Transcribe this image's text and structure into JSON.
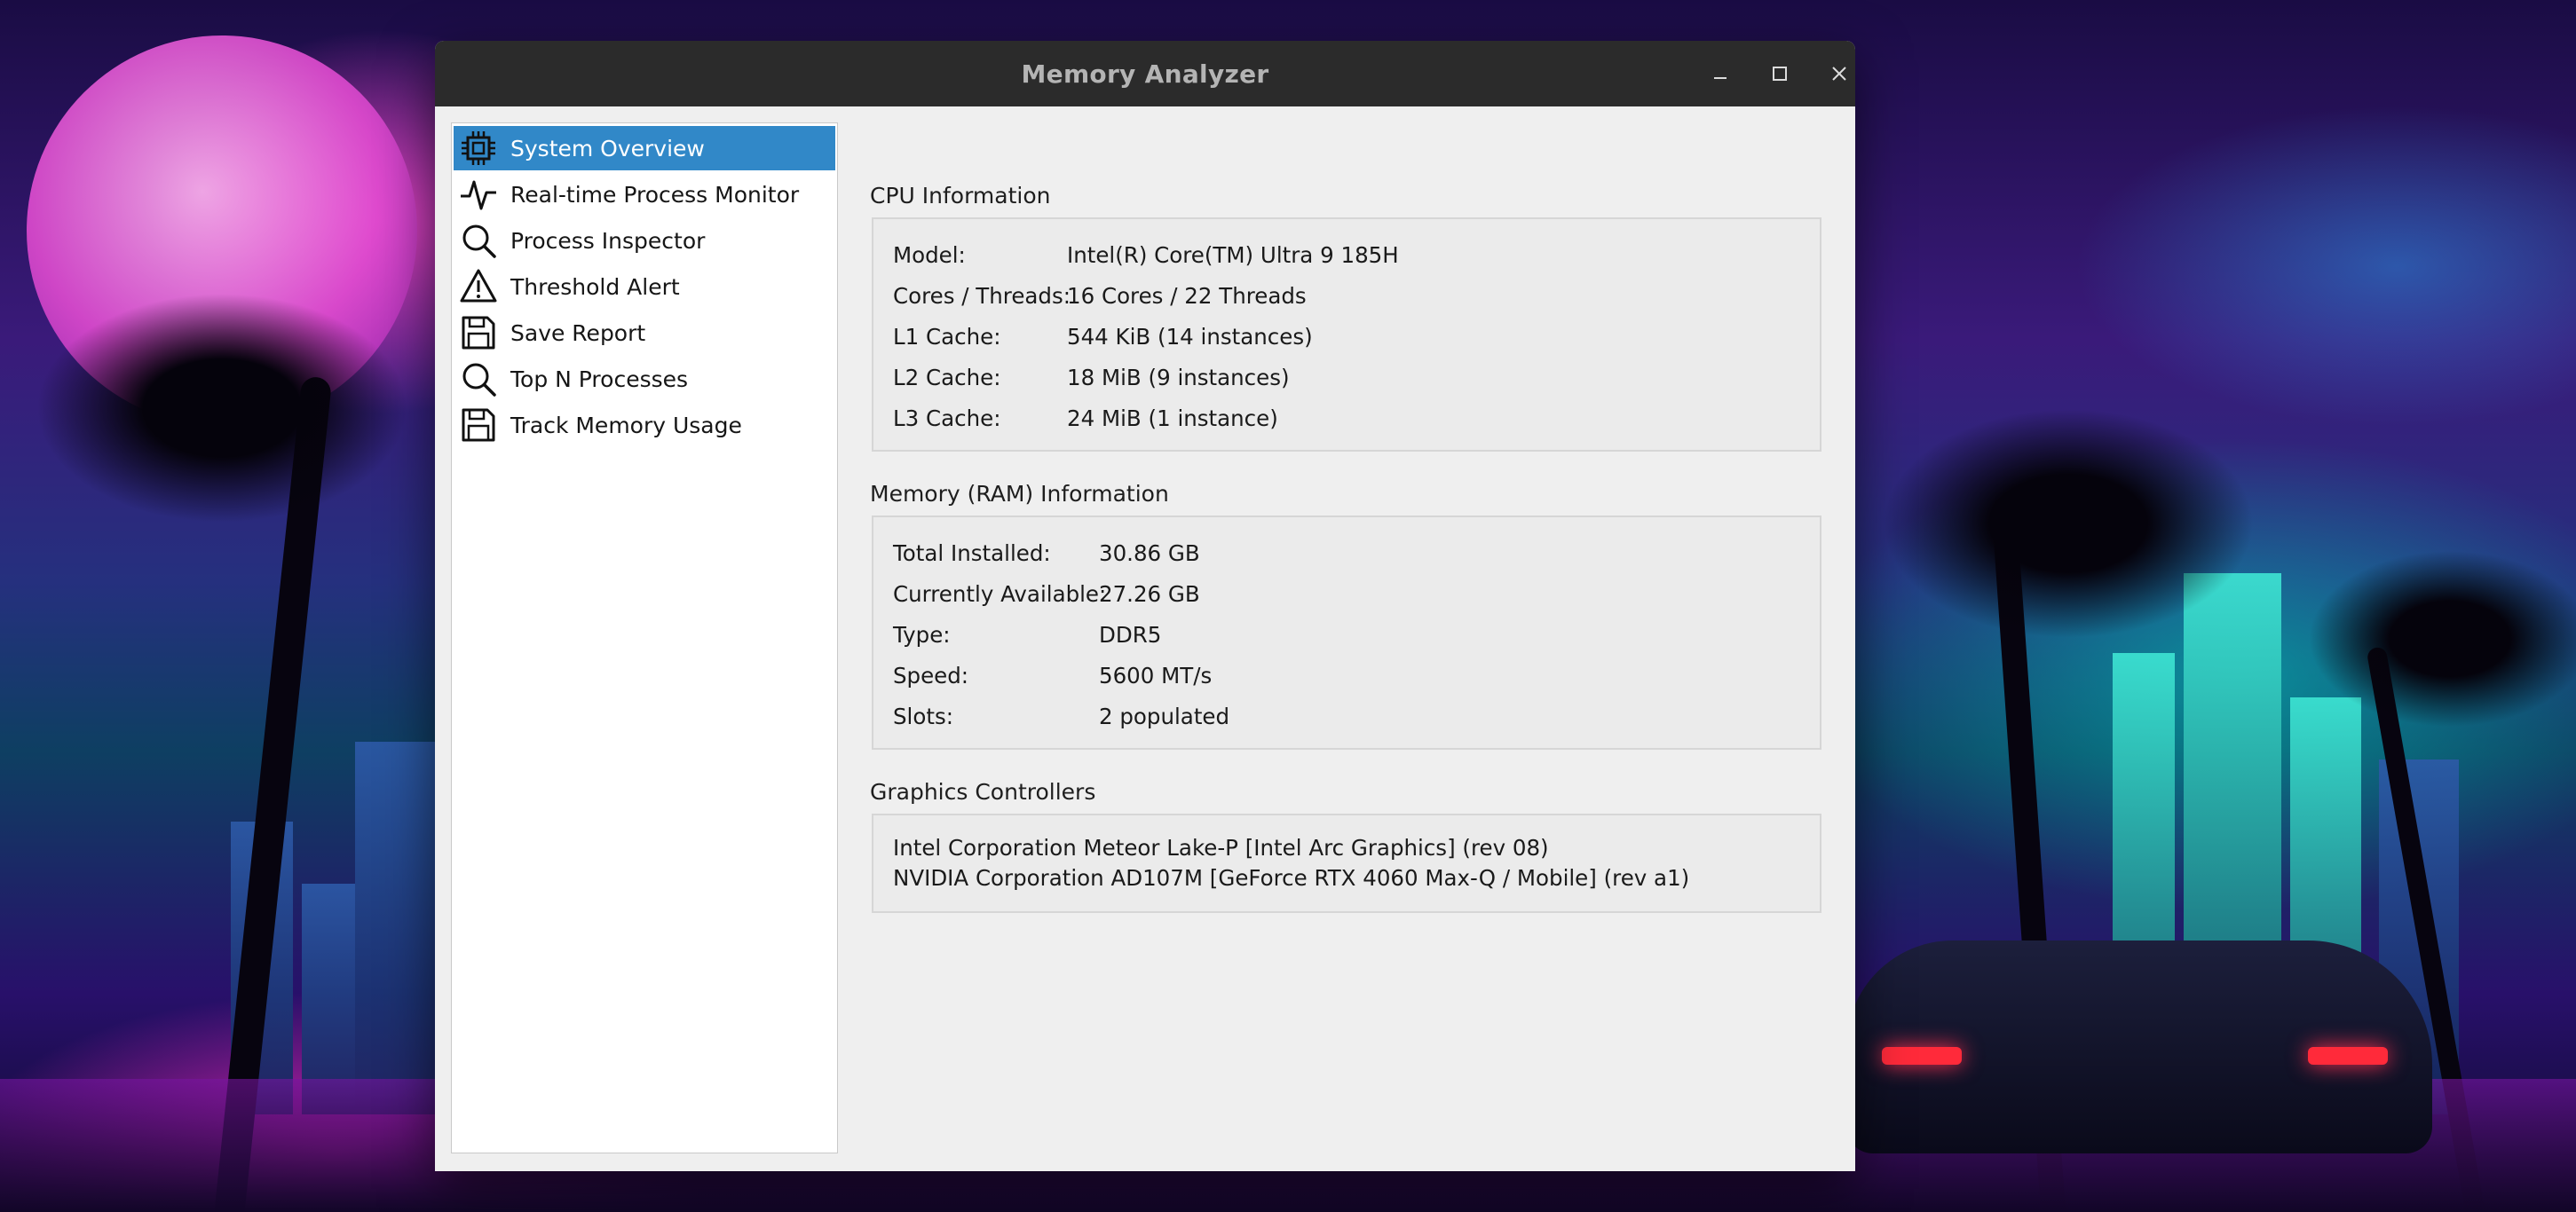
{
  "window": {
    "title": "Memory Analyzer",
    "controls": {
      "minimize": "minimize-icon",
      "maximize": "maximize-icon",
      "close": "close-icon"
    }
  },
  "sidebar": {
    "selected_index": 0,
    "items": [
      {
        "label": "System Overview",
        "icon": "cpu-chip-icon"
      },
      {
        "label": "Real-time Process Monitor",
        "icon": "pulse-icon"
      },
      {
        "label": "Process Inspector",
        "icon": "search-icon"
      },
      {
        "label": "Threshold Alert",
        "icon": "warning-icon"
      },
      {
        "label": "Save Report",
        "icon": "save-icon"
      },
      {
        "label": "Top N Processes",
        "icon": "search-icon"
      },
      {
        "label": "Track Memory Usage",
        "icon": "save-icon"
      }
    ]
  },
  "cpu": {
    "title": "CPU Information",
    "rows": [
      {
        "key": "Model:",
        "value": "Intel(R) Core(TM) Ultra 9 185H"
      },
      {
        "key": "Cores / Threads:",
        "value": "16 Cores / 22 Threads"
      },
      {
        "key": "L1 Cache:",
        "value": "544 KiB (14 instances)"
      },
      {
        "key": "L2 Cache:",
        "value": "18 MiB (9 instances)"
      },
      {
        "key": "L3 Cache:",
        "value": "24 MiB (1 instance)"
      }
    ]
  },
  "memory": {
    "title": "Memory (RAM) Information",
    "rows": [
      {
        "key": "Total Installed:",
        "value": "30.86 GB"
      },
      {
        "key": "Currently Available:",
        "value": "27.26 GB"
      },
      {
        "key": "Type:",
        "value": "DDR5"
      },
      {
        "key": "Speed:",
        "value": "5600 MT/s"
      },
      {
        "key": "Slots:",
        "value": "2 populated"
      }
    ]
  },
  "graphics": {
    "title": "Graphics Controllers",
    "lines": [
      "Intel Corporation Meteor Lake-P [Intel Arc Graphics] (rev 08)",
      "NVIDIA Corporation AD107M [GeForce RTX 4060 Max-Q / Mobile] (rev a1)"
    ]
  },
  "colors": {
    "accent": "#3188c8",
    "titlebar": "#2b2b2b",
    "window_bg": "#efefef"
  }
}
